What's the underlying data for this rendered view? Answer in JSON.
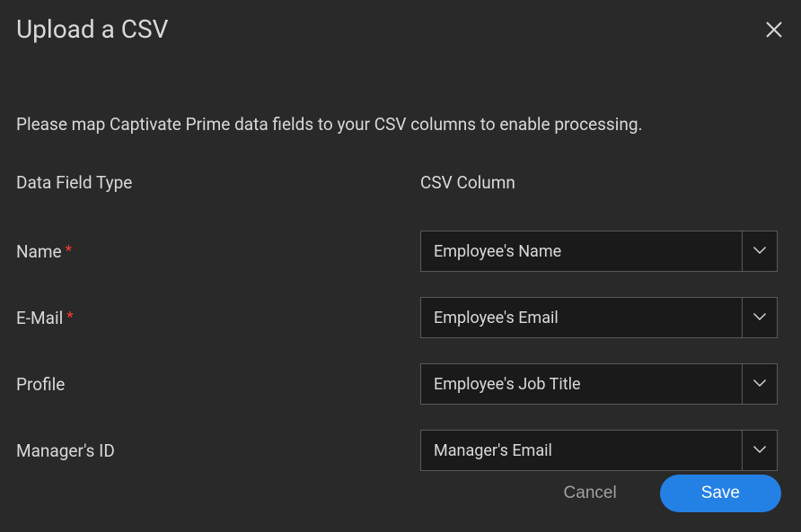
{
  "dialog": {
    "title": "Upload a CSV",
    "instruction": "Please map Captivate Prime data fields to your CSV columns to enable processing.",
    "headers": {
      "data_field": "Data Field Type",
      "csv_column": "CSV Column"
    },
    "fields": [
      {
        "label": "Name",
        "required": true,
        "value": "Employee's Name"
      },
      {
        "label": "E-Mail",
        "required": true,
        "value": "Employee's Email"
      },
      {
        "label": "Profile",
        "required": false,
        "value": "Employee's Job Title"
      },
      {
        "label": "Manager's ID",
        "required": false,
        "value": "Manager's Email"
      }
    ],
    "buttons": {
      "cancel": "Cancel",
      "save": "Save"
    }
  }
}
